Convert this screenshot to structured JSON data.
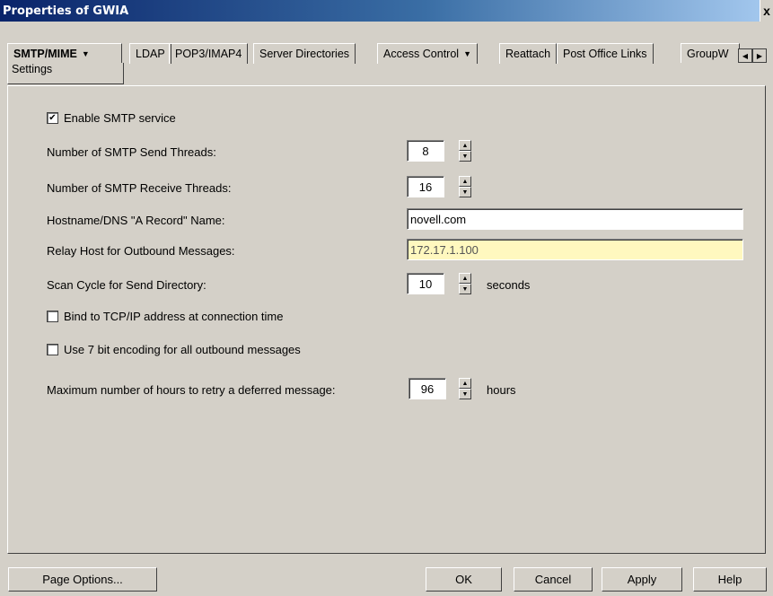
{
  "window": {
    "title": "Properties of GWIA",
    "close_glyph": "x"
  },
  "tabs": [
    {
      "label": "SMTP/MIME",
      "has_menu": true,
      "active": true
    },
    {
      "label": "LDAP"
    },
    {
      "label": "POP3/IMAP4"
    },
    {
      "label": "Server Directories"
    },
    {
      "label": "Access Control",
      "has_menu": true
    },
    {
      "label": "Reattach"
    },
    {
      "label": "Post Office Links"
    },
    {
      "label": "GroupW"
    }
  ],
  "subtab": "Settings",
  "settings": {
    "enable_smtp": {
      "label": "Enable SMTP service",
      "checked": true
    },
    "send_threads": {
      "label": "Number of SMTP Send Threads:",
      "value": "8"
    },
    "receive_threads": {
      "label": "Number of SMTP Receive Threads:",
      "value": "16"
    },
    "hostname": {
      "label": "Hostname/DNS \"A Record\" Name:",
      "value": "novell.com"
    },
    "relay_host": {
      "label": "Relay Host for Outbound Messages:",
      "value": "172.17.1.100"
    },
    "scan_cycle": {
      "label": "Scan Cycle for Send Directory:",
      "value": "10",
      "unit": "seconds"
    },
    "bind_tcpip": {
      "label": "Bind to TCP/IP address at connection time",
      "checked": false
    },
    "seven_bit": {
      "label": "Use 7 bit encoding for all outbound messages",
      "checked": false
    },
    "max_retry": {
      "label": "Maximum number of hours to retry a deferred message:",
      "value": "96",
      "unit": "hours"
    }
  },
  "buttons": {
    "page_options": "Page Options...",
    "ok": "OK",
    "cancel": "Cancel",
    "apply": "Apply",
    "help": "Help"
  }
}
